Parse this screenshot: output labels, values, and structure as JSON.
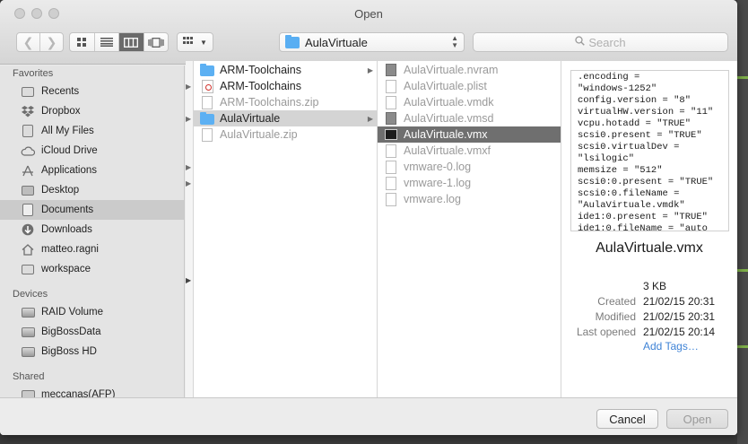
{
  "window": {
    "title": "Open"
  },
  "toolbar": {
    "back_icon": "chevron-left-icon",
    "forward_icon": "chevron-right-icon",
    "view_modes": [
      "icon-view-icon",
      "list-view-icon",
      "column-view-icon",
      "coverflow-view-icon"
    ],
    "selected_view": "column-view-icon",
    "arrange_icon": "arrange-icon",
    "location": "AulaVirtuale",
    "search_placeholder": "Search"
  },
  "sidebar": {
    "favorites_header": "Favorites",
    "favorites": [
      {
        "label": "Recents",
        "icon": "recents-icon"
      },
      {
        "label": "Dropbox",
        "icon": "dropbox-icon"
      },
      {
        "label": "All My Files",
        "icon": "all-files-icon"
      },
      {
        "label": "iCloud Drive",
        "icon": "cloud-icon"
      },
      {
        "label": "Applications",
        "icon": "applications-icon"
      },
      {
        "label": "Desktop",
        "icon": "desktop-icon"
      },
      {
        "label": "Documents",
        "icon": "documents-icon",
        "selected": true
      },
      {
        "label": "Downloads",
        "icon": "downloads-icon"
      },
      {
        "label": "matteo.ragni",
        "icon": "home-icon"
      },
      {
        "label": "workspace",
        "icon": "folder-icon"
      }
    ],
    "devices_header": "Devices",
    "devices": [
      {
        "label": "RAID Volume",
        "icon": "drive-icon"
      },
      {
        "label": "BigBossData",
        "icon": "drive-icon"
      },
      {
        "label": "BigBoss HD",
        "icon": "drive-icon"
      }
    ],
    "shared_header": "Shared",
    "shared": [
      {
        "label": "meccanas(AFP)",
        "icon": "server-icon"
      }
    ]
  },
  "columns": {
    "col2": [
      {
        "name": "ARM-Toolchains",
        "icon": "folder-icon",
        "has_children": true
      },
      {
        "name": "ARM-Toolchains",
        "icon": "image-file-icon"
      },
      {
        "name": "ARM-Toolchains.zip",
        "icon": "zip-file-icon",
        "dim": true
      },
      {
        "name": "AulaVirtuale",
        "icon": "folder-icon",
        "has_children": true,
        "selected": true
      },
      {
        "name": "AulaVirtuale.zip",
        "icon": "zip-file-icon",
        "dim": true
      }
    ],
    "col3": [
      {
        "name": "AulaVirtuale.nvram",
        "icon": "vm-file-icon",
        "dim": true
      },
      {
        "name": "AulaVirtuale.plist",
        "icon": "document-icon",
        "dim": true
      },
      {
        "name": "AulaVirtuale.vmdk",
        "icon": "document-icon",
        "dim": true
      },
      {
        "name": "AulaVirtuale.vmsd",
        "icon": "vm-file-icon",
        "dim": true
      },
      {
        "name": "AulaVirtuale.vmx",
        "icon": "terminal-file-icon",
        "selected": true
      },
      {
        "name": "AulaVirtuale.vmxf",
        "icon": "document-icon",
        "dim": true
      },
      {
        "name": "vmware-0.log",
        "icon": "document-icon",
        "dim": true
      },
      {
        "name": "vmware-1.log",
        "icon": "document-icon",
        "dim": true
      },
      {
        "name": "vmware.log",
        "icon": "document-icon",
        "dim": true
      }
    ]
  },
  "preview": {
    "text": ".encoding =\n\"windows-1252\"\nconfig.version = \"8\"\nvirtualHW.version = \"11\"\nvcpu.hotadd = \"TRUE\"\nscsi0.present = \"TRUE\"\nscsi0.virtualDev =\n\"lsilogic\"\nmemsize = \"512\"\nscsi0:0.present = \"TRUE\"\nscsi0:0.fileName =\n\"AulaVirtuale.vmdk\"\nide1:0.present = \"TRUE\"\nide1:0.fileName = \"auto",
    "filename": "AulaVirtuale.vmx",
    "size": "3 KB",
    "created_label": "Created",
    "created": "21/02/15 20:31",
    "modified_label": "Modified",
    "modified": "21/02/15 20:31",
    "last_opened_label": "Last opened",
    "last_opened": "21/02/15 20:14",
    "add_tags": "Add Tags…"
  },
  "footer": {
    "cancel": "Cancel",
    "open": "Open"
  }
}
